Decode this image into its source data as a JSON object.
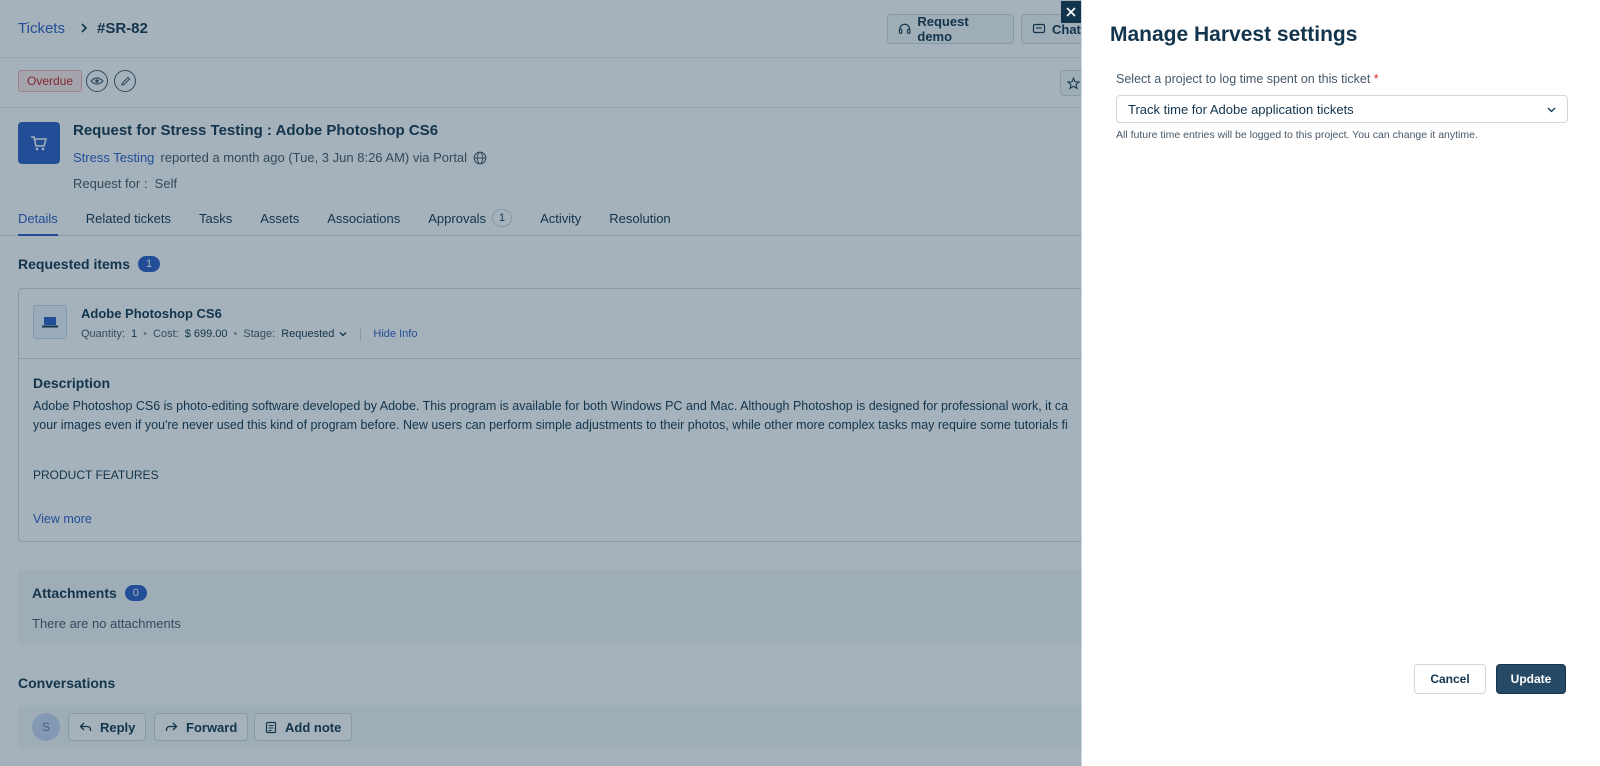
{
  "breadcrumb": {
    "root": "Tickets",
    "ticket_id": "#SR-82"
  },
  "header_actions": {
    "request_demo": "Request demo",
    "chat": "Chat"
  },
  "toolbar": {
    "status_badge": "Overdue"
  },
  "ticket": {
    "title": "Request for Stress Testing : Adobe Photoshop CS6",
    "requester": "Stress Testing",
    "reported": "reported a month ago (Tue, 3 Jun 8:26 AM) via Portal",
    "request_for_label": "Request for :",
    "request_for_value": "Self"
  },
  "tabs": [
    {
      "label": "Details",
      "badge": ""
    },
    {
      "label": "Related tickets",
      "badge": ""
    },
    {
      "label": "Tasks",
      "badge": ""
    },
    {
      "label": "Assets",
      "badge": ""
    },
    {
      "label": "Associations",
      "badge": ""
    },
    {
      "label": "Approvals",
      "badge": "1"
    },
    {
      "label": "Activity",
      "badge": ""
    },
    {
      "label": "Resolution",
      "badge": ""
    }
  ],
  "requested_items": {
    "title": "Requested items",
    "count": "1",
    "item": {
      "name": "Adobe Photoshop CS6",
      "quantity_label": "Quantity:",
      "quantity": "1",
      "cost_label": "Cost:",
      "cost": "$ 699.00",
      "stage_label": "Stage:",
      "stage": "Requested",
      "hide_info": "Hide Info"
    },
    "description_title": "Description",
    "description_line1": "Adobe Photoshop CS6 is photo-editing software developed by Adobe. This program is available for both Windows PC and Mac. Although Photoshop is designed for professional work, it ca",
    "description_line2": "your images even if you're never used this kind of program before. New users can perform simple adjustments to their photos, while other more complex tasks may require some tutorials fi",
    "features": "PRODUCT FEATURES",
    "view_more": "View more"
  },
  "attachments": {
    "title": "Attachments",
    "count": "0",
    "empty": "There are no attachments"
  },
  "conversations": {
    "title": "Conversations",
    "avatar_initial": "S",
    "reply": "Reply",
    "forward": "Forward",
    "add_note": "Add note"
  },
  "drawer": {
    "title": "Manage Harvest settings",
    "field_label": "Select a project to log time spent on this ticket",
    "required_mark": "*",
    "selected_project": "Track time for Adobe application tickets",
    "help_text": "All future time entries will be logged to this project. You can change it anytime.",
    "cancel": "Cancel",
    "update": "Update"
  },
  "colors": {
    "accent": "#2c5cc5",
    "primary_dark": "#264966",
    "overdue": "#c82124"
  }
}
